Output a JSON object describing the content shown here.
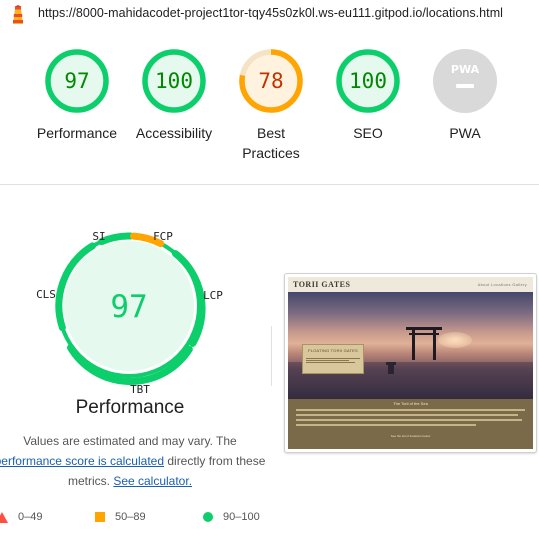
{
  "page": {
    "url": "https://8000-mahidacodet-project1tor-tqy45s0zk0l.ws-eu111.gitpod.io/locations.html"
  },
  "colors": {
    "pass": "#0cce6b",
    "pass_text": "#008800",
    "pass_bg": "#e6f9ee",
    "average": "#ffa400",
    "average_text": "#c33300",
    "average_bg": "#fff3e0",
    "fail": "#ff4e42",
    "pwa_gray": "#d9d9d9"
  },
  "gauges": [
    {
      "score": 97,
      "label": "Performance",
      "rating": "pass"
    },
    {
      "score": 100,
      "label": "Accessibility",
      "rating": "pass"
    },
    {
      "score": 78,
      "label": "Best Practices",
      "label_line1": "Best",
      "label_line2": "Practices",
      "rating": "average"
    },
    {
      "score": 100,
      "label": "SEO",
      "rating": "pass"
    },
    {
      "label": "PWA",
      "badge_text": "PWA",
      "icon": "pwa-badge-icon"
    }
  ],
  "performance": {
    "score": 97,
    "title": "Performance",
    "metrics": [
      {
        "abbr": "SI",
        "rating": "pass"
      },
      {
        "abbr": "FCP",
        "rating": "average"
      },
      {
        "abbr": "LCP",
        "rating": "pass"
      },
      {
        "abbr": "TBT",
        "rating": "pass"
      },
      {
        "abbr": "CLS",
        "rating": "pass"
      }
    ],
    "note_part1": "Values are estimated and may vary. The",
    "note_link1": "performance score is calculated",
    "note_part2": " directly from these",
    "note_part3": "metrics. ",
    "note_link2": "See calculator."
  },
  "legend": [
    {
      "range": "0–49",
      "icon": "triangle-icon"
    },
    {
      "range": "50–89",
      "icon": "square-icon"
    },
    {
      "range": "90–100",
      "icon": "circle-icon"
    }
  ],
  "screenshot": {
    "site_title": "TORII GATES",
    "nav_text": "About   Locations   Gallery",
    "hero_box_title": "FLOATING TORII GATES",
    "content_heading": "The Torii of the Sea",
    "content_caption": "See the list of locations below"
  }
}
